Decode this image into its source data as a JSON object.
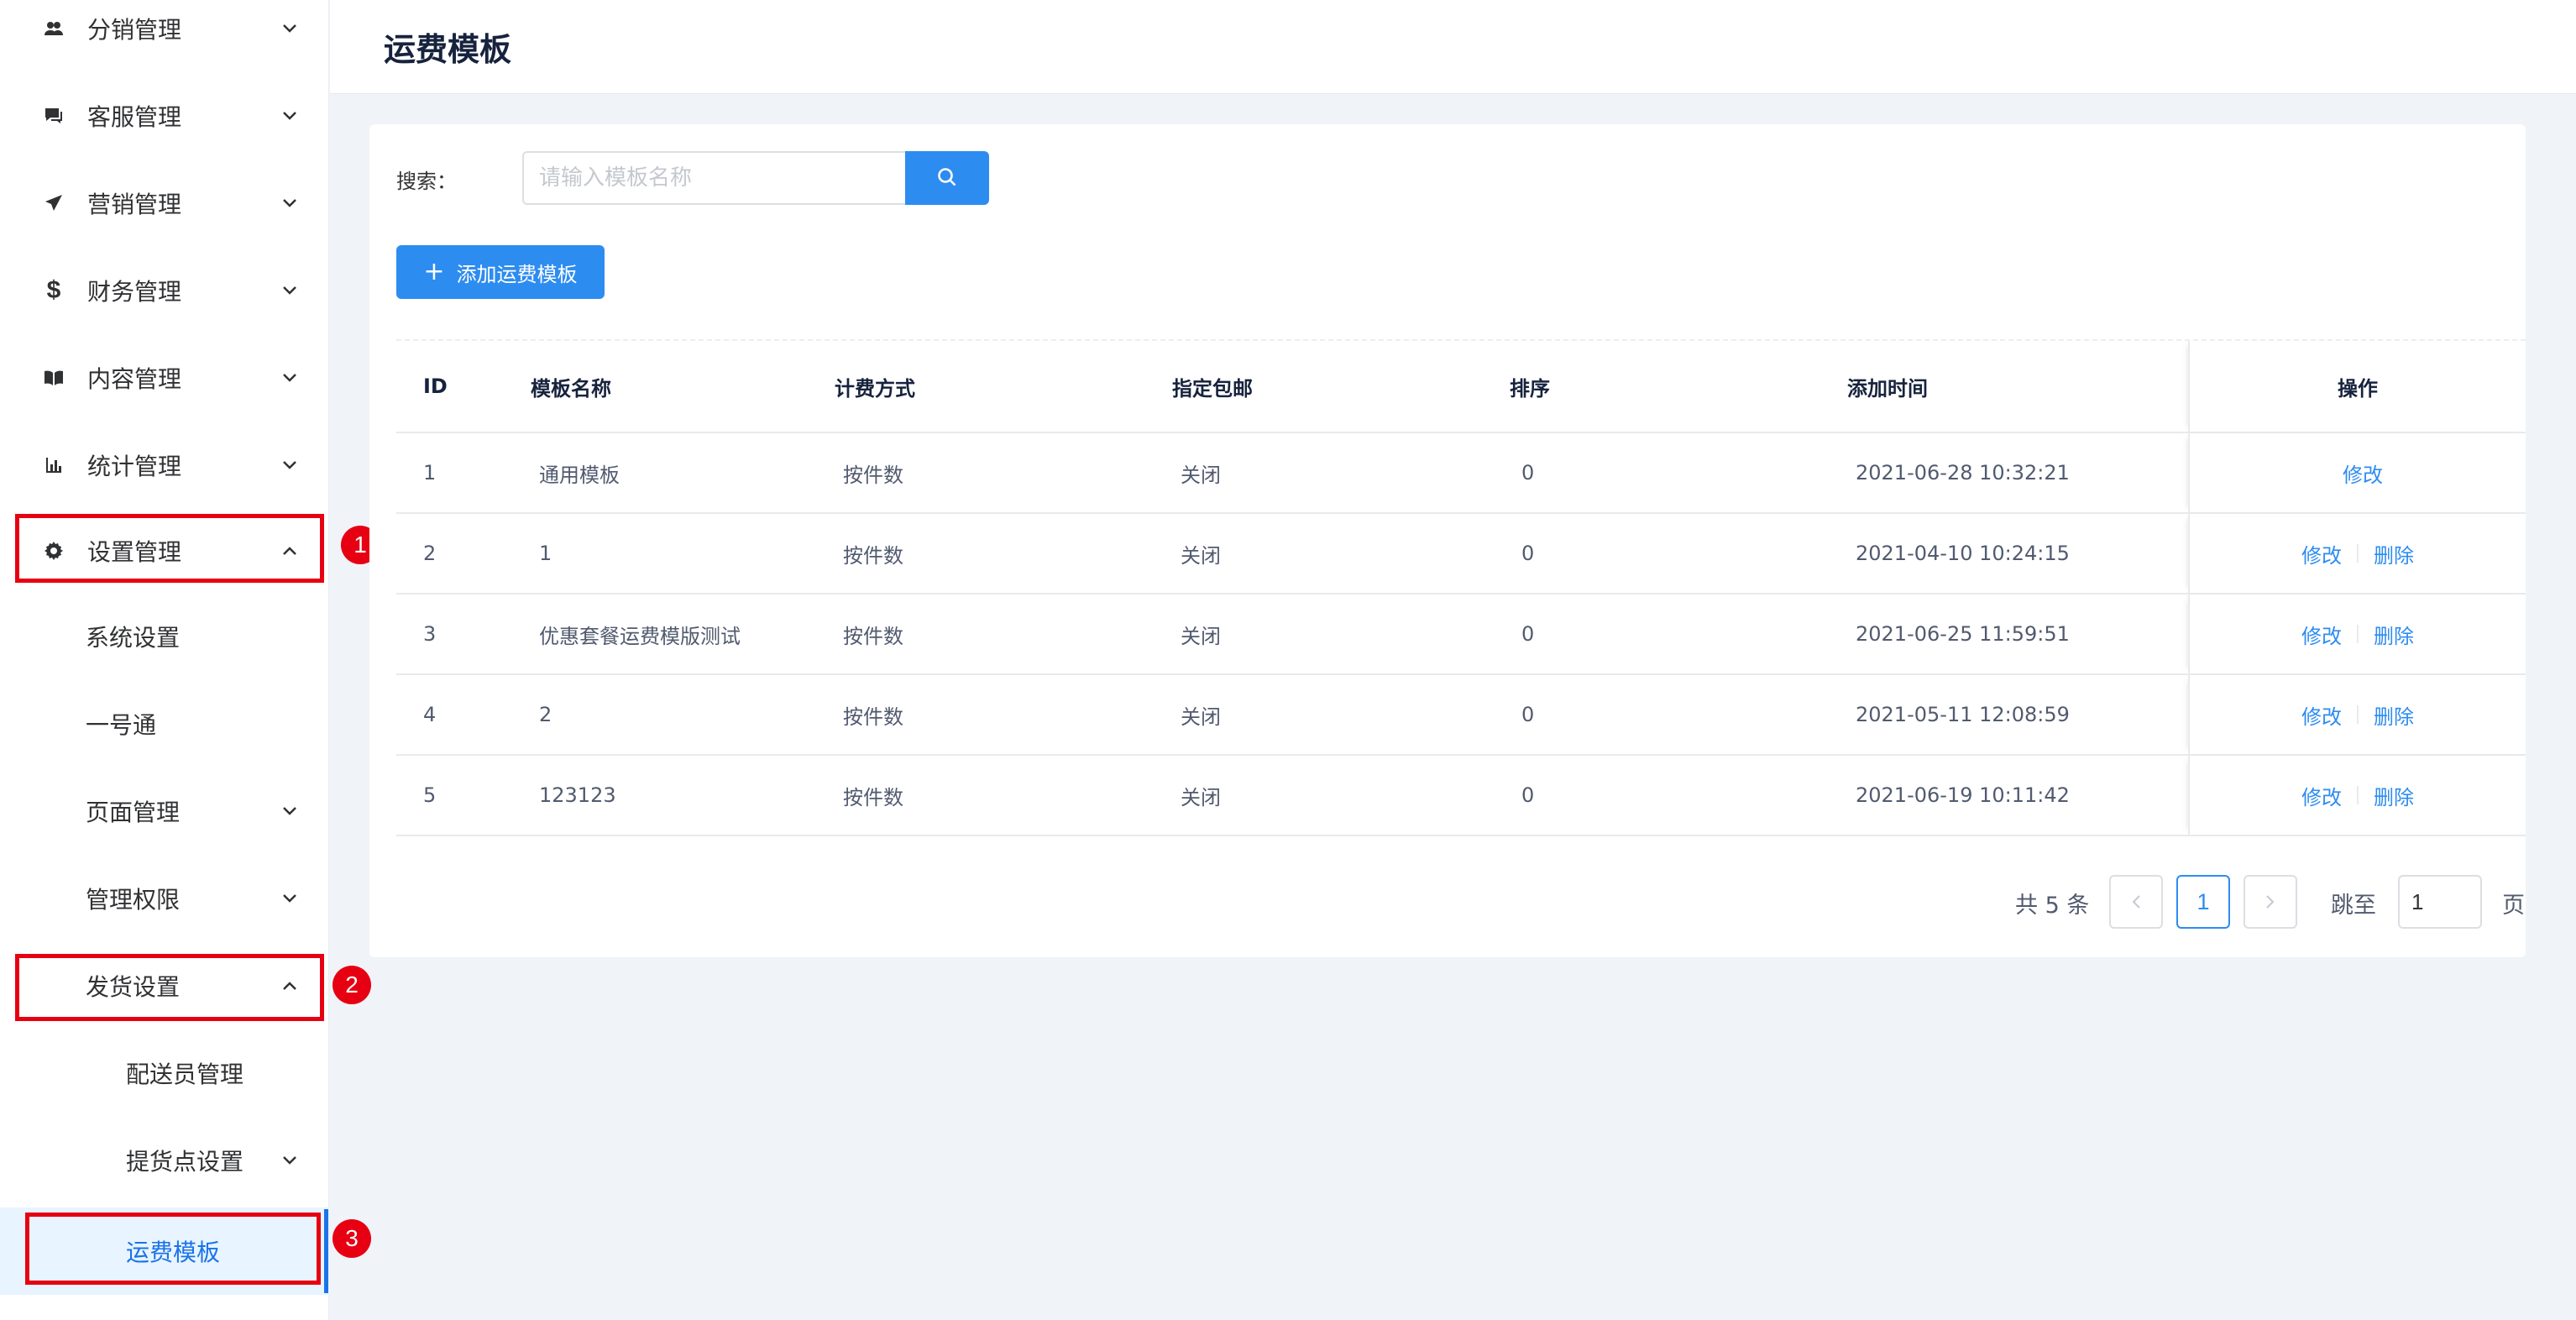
{
  "page": {
    "title": "运费模板"
  },
  "sidebar": {
    "items": [
      {
        "label": "分销管理",
        "icon": "users-icon"
      },
      {
        "label": "客服管理",
        "icon": "chat-icon"
      },
      {
        "label": "营销管理",
        "icon": "send-icon"
      },
      {
        "label": "财务管理",
        "icon": "dollar-icon"
      },
      {
        "label": "内容管理",
        "icon": "book-icon"
      },
      {
        "label": "统计管理",
        "icon": "bar-chart-icon"
      },
      {
        "label": "设置管理",
        "icon": "gear-icon"
      }
    ],
    "settings_children": [
      {
        "label": "系统设置"
      },
      {
        "label": "一号通"
      },
      {
        "label": "页面管理"
      },
      {
        "label": "管理权限"
      },
      {
        "label": "发货设置"
      }
    ],
    "shipping_children": [
      {
        "label": "配送员管理"
      },
      {
        "label": "提货点设置"
      },
      {
        "label": "运费模板"
      }
    ],
    "active_item": "运费模板"
  },
  "annotations": {
    "badges": [
      "1",
      "2",
      "3"
    ],
    "highlight_color": "#e60012"
  },
  "search": {
    "label": "搜索：",
    "placeholder": "请输入模板名称",
    "value": ""
  },
  "toolbar": {
    "add_label": "添加运费模板"
  },
  "table": {
    "headers": {
      "id": "ID",
      "name": "模板名称",
      "fee": "计费方式",
      "free": "指定包邮",
      "sort": "排序",
      "time": "添加时间",
      "ops": "操作"
    },
    "rows": [
      {
        "id": "1",
        "name": "通用模板",
        "fee": "按件数",
        "free": "关闭",
        "sort": "0",
        "time": "2021-06-28 10:32:21",
        "edit": "修改",
        "delete": ""
      },
      {
        "id": "2",
        "name": "1",
        "fee": "按件数",
        "free": "关闭",
        "sort": "0",
        "time": "2021-04-10 10:24:15",
        "edit": "修改",
        "delete": "删除"
      },
      {
        "id": "3",
        "name": "优惠套餐运费模版测试",
        "fee": "按件数",
        "free": "关闭",
        "sort": "0",
        "time": "2021-06-25 11:59:51",
        "edit": "修改",
        "delete": "删除"
      },
      {
        "id": "4",
        "name": "2",
        "fee": "按件数",
        "free": "关闭",
        "sort": "0",
        "time": "2021-05-11 12:08:59",
        "edit": "修改",
        "delete": "删除"
      },
      {
        "id": "5",
        "name": "123123",
        "fee": "按件数",
        "free": "关闭",
        "sort": "0",
        "time": "2021-06-19 10:11:42",
        "edit": "修改",
        "delete": "删除"
      }
    ]
  },
  "pagination": {
    "total": "共 5 条",
    "current": "1",
    "jump_label": "跳至",
    "jump_value": "1",
    "page_unit": "页"
  },
  "colors": {
    "accent": "#2d8cf0",
    "active_bg": "#e8f4ff",
    "annotation": "#e60012"
  }
}
